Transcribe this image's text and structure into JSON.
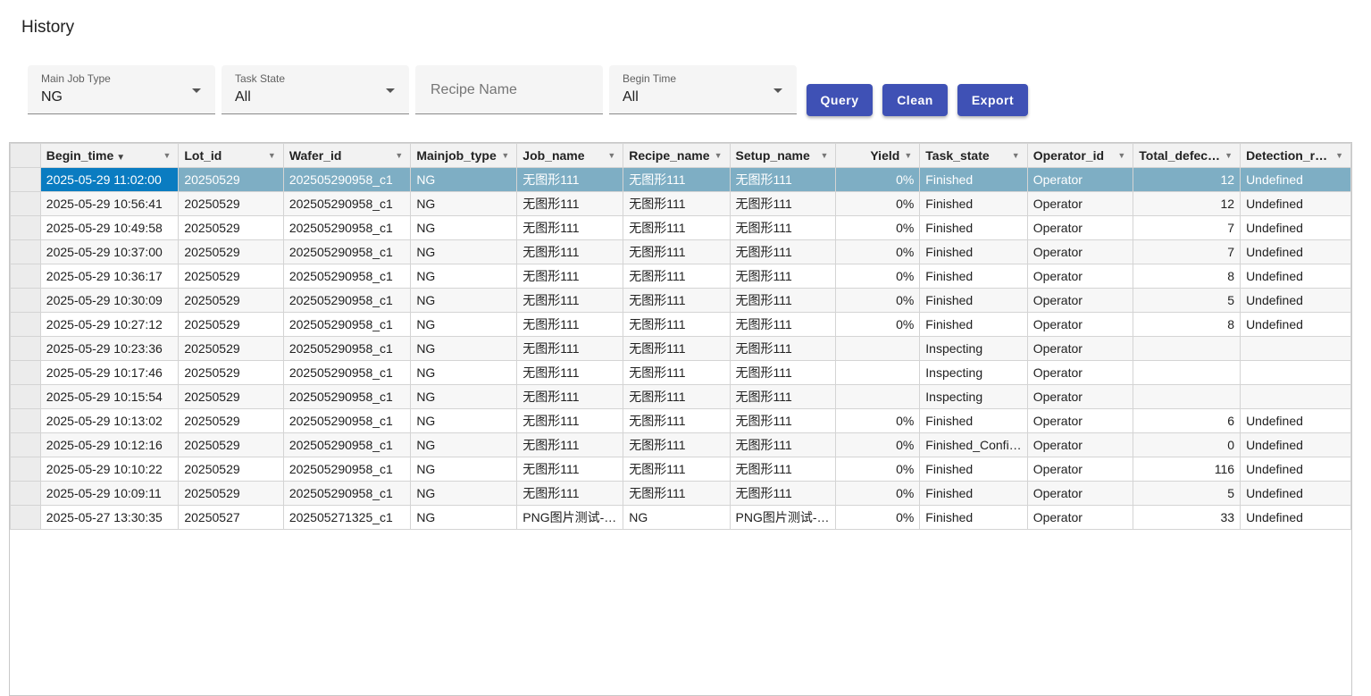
{
  "page": {
    "title": "History"
  },
  "filters": {
    "main_job_type": {
      "label": "Main Job Type",
      "value": "NG"
    },
    "task_state": {
      "label": "Task State",
      "value": "All"
    },
    "recipe_name": {
      "placeholder": "Recipe Name",
      "value": ""
    },
    "begin_time": {
      "label": "Begin Time",
      "value": "All"
    }
  },
  "buttons": {
    "query": "Query",
    "clean": "Clean",
    "export": "Export"
  },
  "icons": {
    "filter": "filter-icon",
    "sort": "sort-down-icon",
    "dropdown": "chevron-down-icon"
  },
  "colors": {
    "accent": "#3f51b5",
    "selected_row": "#7eaec4",
    "active_cell": "#0a7cc1"
  },
  "table": {
    "headers": [
      "Begin_time",
      "Lot_id",
      "Wafer_id",
      "Mainjob_type",
      "Job_name",
      "Recipe_name",
      "Setup_name",
      "Yield",
      "Task_state",
      "Operator_id",
      "Total_defec…",
      "Detection_r…"
    ],
    "sorted_column": "Begin_time",
    "rows": [
      [
        "2025-05-29 11:02:00",
        "20250529",
        "202505290958_c1",
        "NG",
        "无图形111",
        "无图形111",
        "无图形111",
        "0%",
        "Finished",
        "Operator",
        "12",
        "Undefined"
      ],
      [
        "2025-05-29 10:56:41",
        "20250529",
        "202505290958_c1",
        "NG",
        "无图形111",
        "无图形111",
        "无图形111",
        "0%",
        "Finished",
        "Operator",
        "12",
        "Undefined"
      ],
      [
        "2025-05-29 10:49:58",
        "20250529",
        "202505290958_c1",
        "NG",
        "无图形111",
        "无图形111",
        "无图形111",
        "0%",
        "Finished",
        "Operator",
        "7",
        "Undefined"
      ],
      [
        "2025-05-29 10:37:00",
        "20250529",
        "202505290958_c1",
        "NG",
        "无图形111",
        "无图形111",
        "无图形111",
        "0%",
        "Finished",
        "Operator",
        "7",
        "Undefined"
      ],
      [
        "2025-05-29 10:36:17",
        "20250529",
        "202505290958_c1",
        "NG",
        "无图形111",
        "无图形111",
        "无图形111",
        "0%",
        "Finished",
        "Operator",
        "8",
        "Undefined"
      ],
      [
        "2025-05-29 10:30:09",
        "20250529",
        "202505290958_c1",
        "NG",
        "无图形111",
        "无图形111",
        "无图形111",
        "0%",
        "Finished",
        "Operator",
        "5",
        "Undefined"
      ],
      [
        "2025-05-29 10:27:12",
        "20250529",
        "202505290958_c1",
        "NG",
        "无图形111",
        "无图形111",
        "无图形111",
        "0%",
        "Finished",
        "Operator",
        "8",
        "Undefined"
      ],
      [
        "2025-05-29 10:23:36",
        "20250529",
        "202505290958_c1",
        "NG",
        "无图形111",
        "无图形111",
        "无图形111",
        "",
        "Inspecting",
        "Operator",
        "",
        ""
      ],
      [
        "2025-05-29 10:17:46",
        "20250529",
        "202505290958_c1",
        "NG",
        "无图形111",
        "无图形111",
        "无图形111",
        "",
        "Inspecting",
        "Operator",
        "",
        ""
      ],
      [
        "2025-05-29 10:15:54",
        "20250529",
        "202505290958_c1",
        "NG",
        "无图形111",
        "无图形111",
        "无图形111",
        "",
        "Inspecting",
        "Operator",
        "",
        ""
      ],
      [
        "2025-05-29 10:13:02",
        "20250529",
        "202505290958_c1",
        "NG",
        "无图形111",
        "无图形111",
        "无图形111",
        "0%",
        "Finished",
        "Operator",
        "6",
        "Undefined"
      ],
      [
        "2025-05-29 10:12:16",
        "20250529",
        "202505290958_c1",
        "NG",
        "无图形111",
        "无图形111",
        "无图形111",
        "0%",
        "Finished_Confi…",
        "Operator",
        "0",
        "Undefined"
      ],
      [
        "2025-05-29 10:10:22",
        "20250529",
        "202505290958_c1",
        "NG",
        "无图形111",
        "无图形111",
        "无图形111",
        "0%",
        "Finished",
        "Operator",
        "116",
        "Undefined"
      ],
      [
        "2025-05-29 10:09:11",
        "20250529",
        "202505290958_c1",
        "NG",
        "无图形111",
        "无图形111",
        "无图形111",
        "0%",
        "Finished",
        "Operator",
        "5",
        "Undefined"
      ],
      [
        "2025-05-27 13:30:35",
        "20250527",
        "202505271325_c1",
        "NG",
        "PNG图片测试-…",
        "NG",
        "PNG图片测试-…",
        "0%",
        "Finished",
        "Operator",
        "33",
        "Undefined"
      ]
    ]
  }
}
